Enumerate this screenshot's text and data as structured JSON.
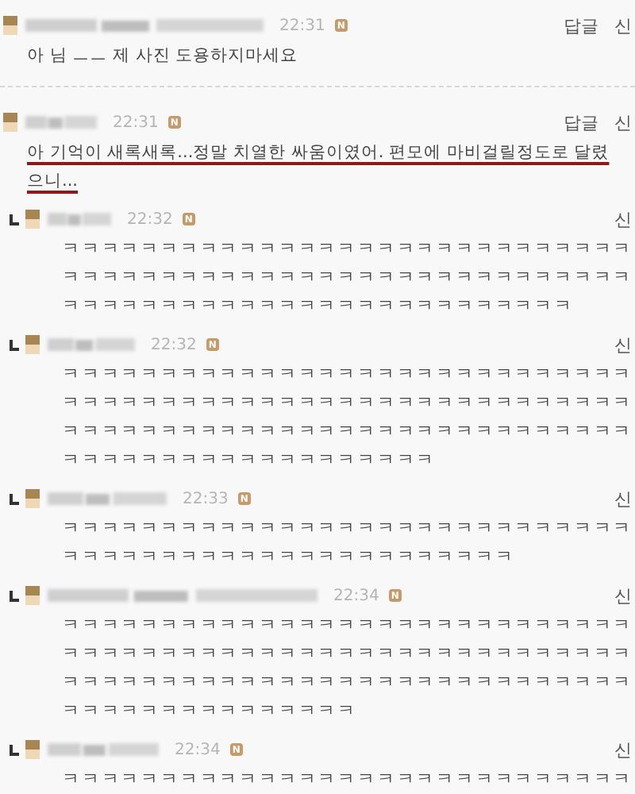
{
  "comments": [
    {
      "kind": "comment",
      "time": "22:31",
      "badge": "N",
      "actions": [
        "답글",
        "신"
      ],
      "text": "아 님 ㅡㅡ 제 사진 도용하지마세요",
      "highlighted": false
    },
    {
      "kind": "comment",
      "time": "22:31",
      "badge": "N",
      "actions": [
        "답글",
        "신"
      ],
      "text": "아 기억이 새록새록...정말 치열한 싸움이였어. 편모에 마비걸릴정도로 달렸으니...",
      "highlighted": true
    },
    {
      "kind": "reply",
      "time": "22:32",
      "badge": "N",
      "actions": [
        "신"
      ],
      "text": "ㅋㅋㅋㅋㅋㅋㅋㅋㅋㅋㅋㅋㅋㅋㅋㅋㅋㅋㅋㅋㅋㅋㅋㅋㅋㅋㅋㅋㅋㅋㅋㅋㅋㅋㅋㅋㅋㅋㅋㅋㅋㅋㅋㅋㅋㅋㅋㅋㅋㅋㅋㅋㅋㅋㅋㅋㅋㅋㅋㅋㅋㅋㅋㅋㅋㅋㅋㅋㅋㅋㅋㅋㅋㅋㅋㅋㅋㅋㅋㅋㅋㅋㅋㅋ",
      "highlighted": false
    },
    {
      "kind": "reply",
      "time": "22:32",
      "badge": "N",
      "actions": [
        "신"
      ],
      "text": "ㅋㅋㅋㅋㅋㅋㅋㅋㅋㅋㅋㅋㅋㅋㅋㅋㅋㅋㅋㅋㅋㅋㅋㅋㅋㅋㅋㅋㅋㅋㅋㅋㅋㅋㅋㅋㅋㅋㅋㅋㅋㅋㅋㅋㅋㅋㅋㅋㅋㅋㅋㅋㅋㅋㅋㅋㅋㅋㅋㅋㅋㅋㅋㅋㅋㅋㅋㅋㅋㅋㅋㅋㅋㅋㅋㅋㅋㅋㅋㅋㅋㅋㅋㅋㅋㅋㅋㅋㅋㅋㅋㅋㅋㅋㅋㅋㅋㅋㅋㅋㅋㅋㅋㅋㅋㅋ",
      "highlighted": false
    },
    {
      "kind": "reply",
      "time": "22:33",
      "badge": "N",
      "actions": [
        "신"
      ],
      "text": "ㅋㅋㅋㅋㅋㅋㅋㅋㅋㅋㅋㅋㅋㅋㅋㅋㅋㅋㅋㅋㅋㅋㅋㅋㅋㅋㅋㅋㅋㅋㅋㅋㅋㅋㅋㅋㅋㅋㅋㅋㅋㅋㅋㅋㅋㅋㅋㅋㅋㅋㅋㅋ",
      "highlighted": false
    },
    {
      "kind": "reply",
      "time": "22:34",
      "badge": "N",
      "actions": [
        "신"
      ],
      "text": "ㅋㅋㅋㅋㅋㅋㅋㅋㅋㅋㅋㅋㅋㅋㅋㅋㅋㅋㅋㅋㅋㅋㅋㅋㅋㅋㅋㅋㅋㅋㅋㅋㅋㅋㅋㅋㅋㅋㅋㅋㅋㅋㅋㅋㅋㅋㅋㅋㅋㅋㅋㅋㅋㅋㅋㅋㅋㅋㅋㅋㅋㅋㅋㅋㅋㅋㅋㅋㅋㅋㅋㅋㅋㅋㅋㅋㅋㅋㅋㅋㅋㅋㅋㅋㅋㅋㅋㅋㅋㅋㅋㅋㅋㅋㅋㅋㅋㅋㅋㅋㅋㅋ",
      "highlighted": false
    },
    {
      "kind": "reply",
      "time": "22:34",
      "badge": "N",
      "actions": [
        "신"
      ],
      "text": "ㅋㅋㅋㅋㅋㅋㅋㅋㅋㅋㅋㅋㅋㅋㅋㅋㅋㅋㅋㅋㅋㅋㅋㅋㅋㅋㅋㅋㅋ",
      "highlighted": false
    }
  ]
}
